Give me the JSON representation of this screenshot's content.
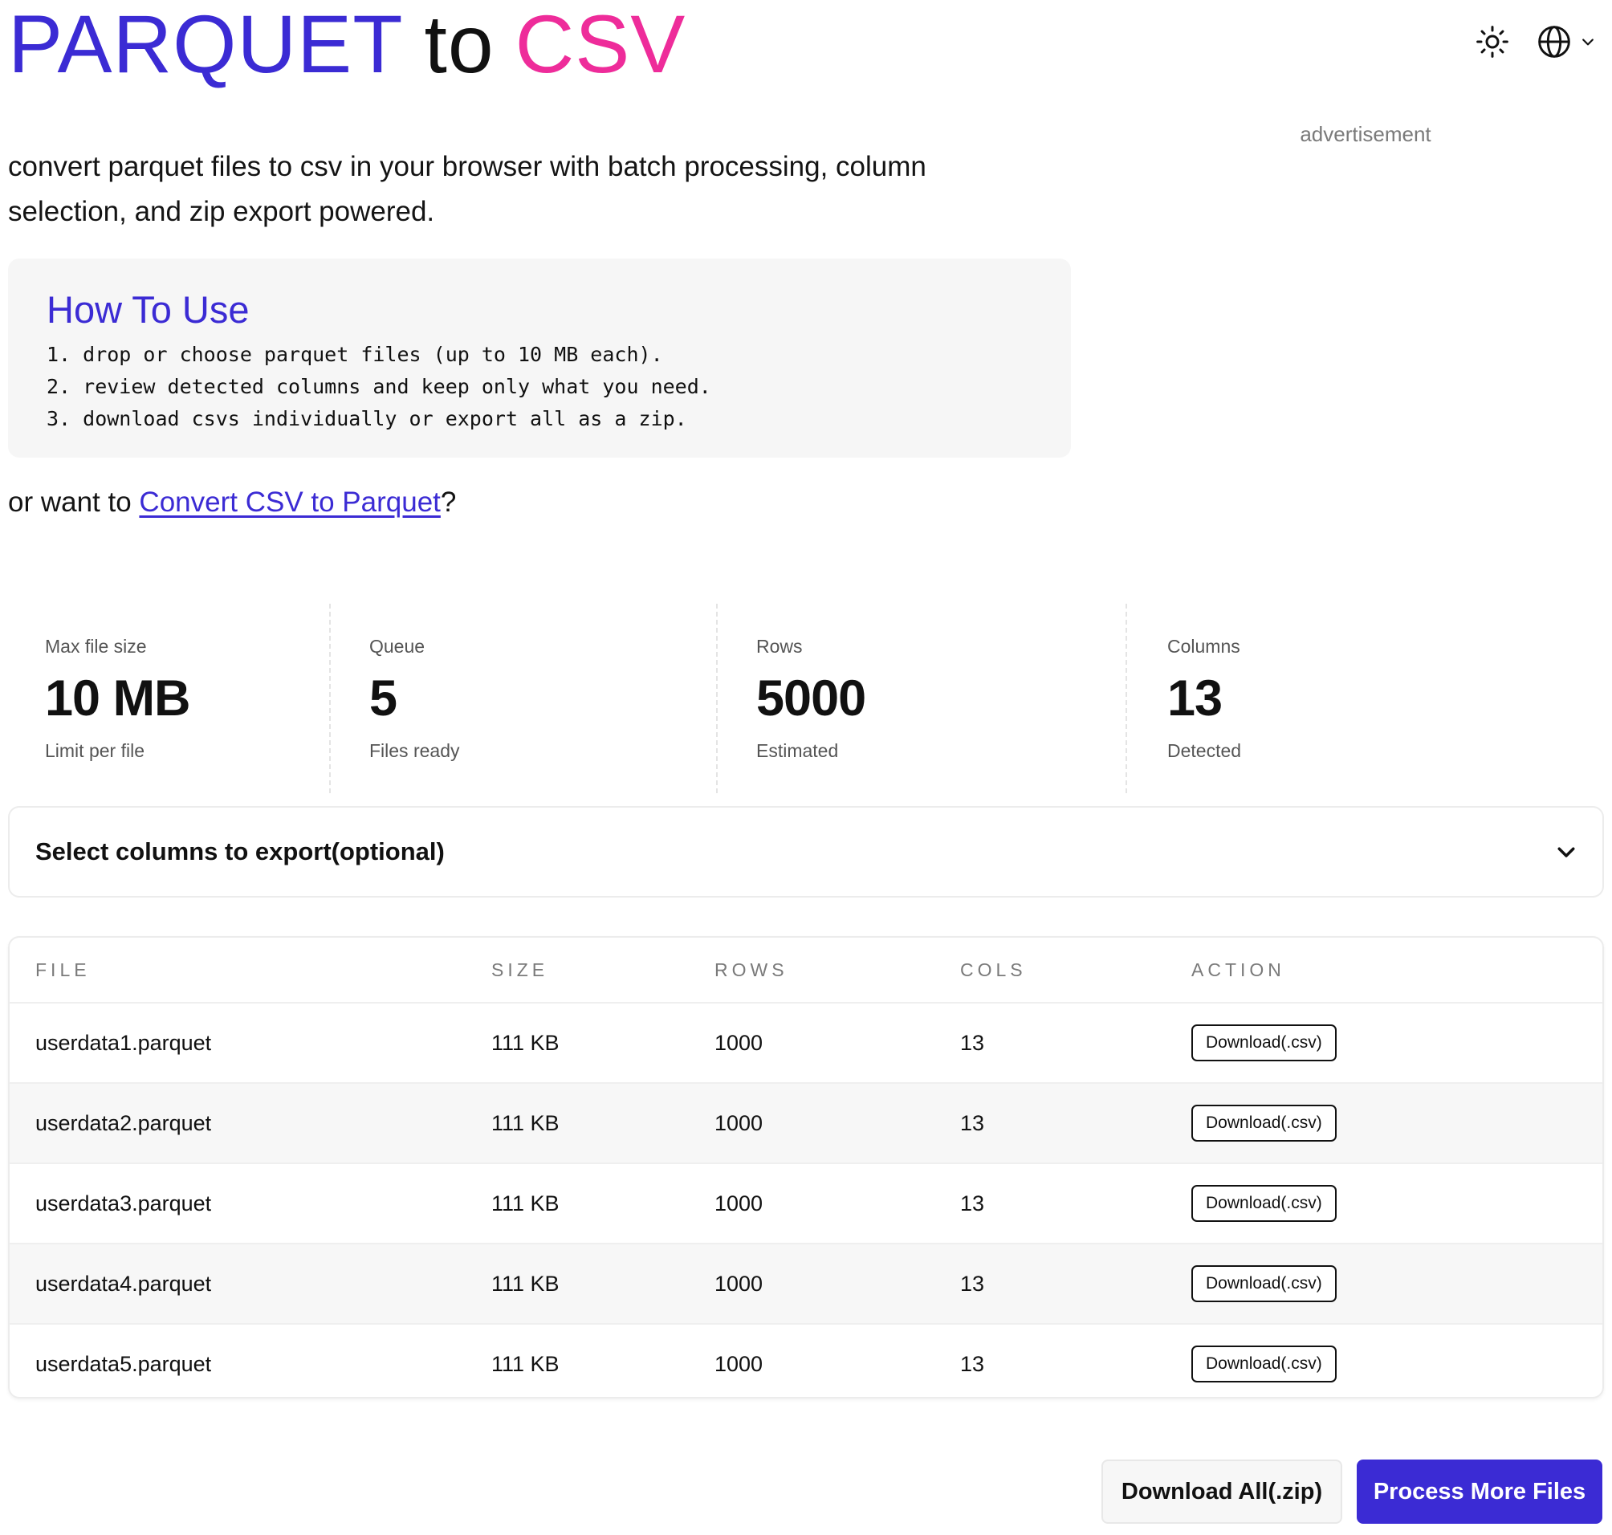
{
  "header": {
    "title_part1": "PARQUET",
    "title_part2": "to",
    "title_part3": "CSV",
    "theme_icon": "sun-icon",
    "language_icon": "globe-icon"
  },
  "colors": {
    "brand": "#3b2bd4",
    "accent": "#ee2c9a"
  },
  "advertisement_label": "advertisement",
  "tagline": "convert parquet files to csv in your browser with batch processing, column selection, and zip export powered.",
  "how_to_use": {
    "title": "How To Use",
    "steps": [
      "1. drop or choose parquet files (up to 10 MB each).",
      "2. review detected columns and keep only what you need.",
      "3. download csvs individually or export all as a zip."
    ]
  },
  "alt_link": {
    "prefix": "or want to ",
    "link_text": "Convert CSV to Parquet",
    "suffix": "?"
  },
  "stats": [
    {
      "label": "Max file size",
      "value": "10 MB",
      "sub": "Limit per file"
    },
    {
      "label": "Queue",
      "value": "5",
      "sub": "Files ready"
    },
    {
      "label": "Rows",
      "value": "5000",
      "sub": "Estimated"
    },
    {
      "label": "Columns",
      "value": "13",
      "sub": "Detected"
    }
  ],
  "column_selector": {
    "label": "Select columns to export(optional)"
  },
  "table": {
    "headers": [
      "FILE",
      "SIZE",
      "ROWS",
      "COLS",
      "ACTION"
    ],
    "rows": [
      {
        "file": "userdata1.parquet",
        "size": "111 KB",
        "rows": "1000",
        "cols": "13",
        "action": "Download(.csv)"
      },
      {
        "file": "userdata2.parquet",
        "size": "111 KB",
        "rows": "1000",
        "cols": "13",
        "action": "Download(.csv)"
      },
      {
        "file": "userdata3.parquet",
        "size": "111 KB",
        "rows": "1000",
        "cols": "13",
        "action": "Download(.csv)"
      },
      {
        "file": "userdata4.parquet",
        "size": "111 KB",
        "rows": "1000",
        "cols": "13",
        "action": "Download(.csv)"
      },
      {
        "file": "userdata5.parquet",
        "size": "111 KB",
        "rows": "1000",
        "cols": "13",
        "action": "Download(.csv)"
      }
    ]
  },
  "footer_actions": {
    "download_all": "Download All(.zip)",
    "process_more": "Process More Files"
  }
}
